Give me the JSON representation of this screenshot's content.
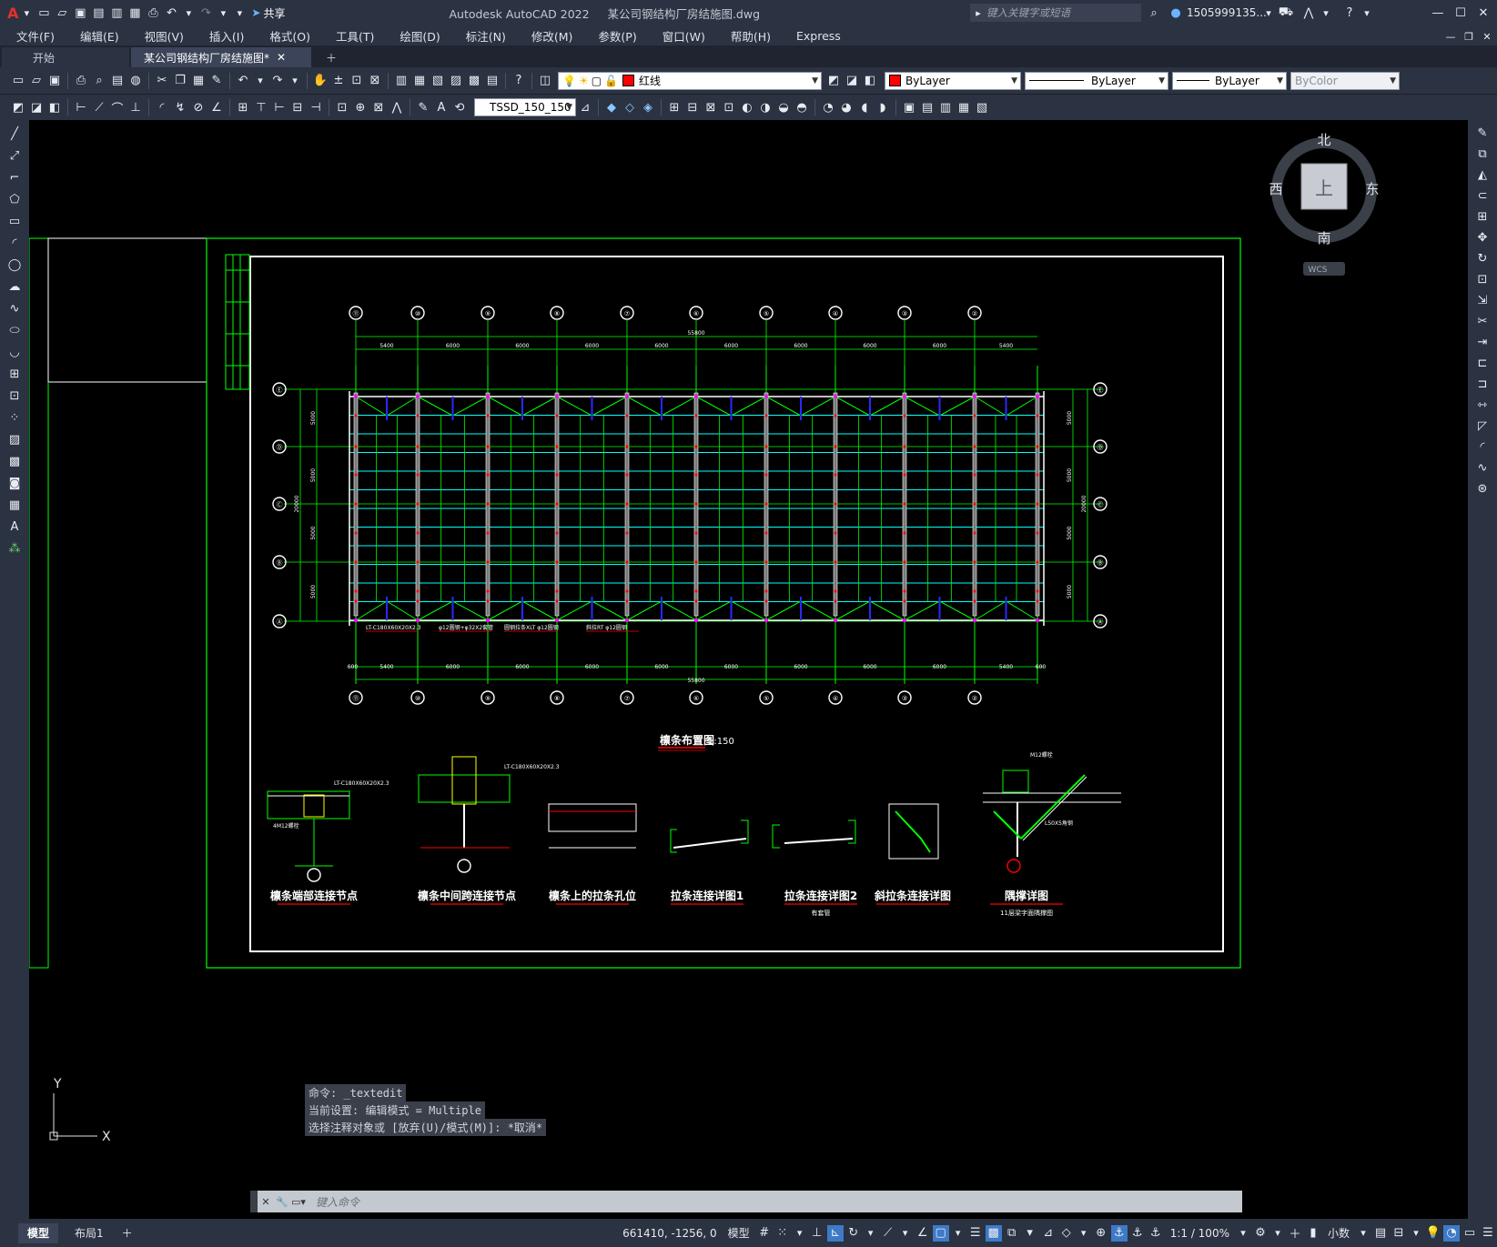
{
  "window": {
    "app_title": "Autodesk AutoCAD 2022",
    "file_title": "某公司钢结构厂房结施图.dwg",
    "search_placeholder": "键入关键字或短语",
    "user": "1505999135...",
    "share_label": "共享"
  },
  "menu": [
    "文件(F)",
    "编辑(E)",
    "视图(V)",
    "插入(I)",
    "格式(O)",
    "工具(T)",
    "绘图(D)",
    "标注(N)",
    "修改(M)",
    "参数(P)",
    "窗口(W)",
    "帮助(H)",
    "Express"
  ],
  "tabs": [
    {
      "label": "开始",
      "active": false
    },
    {
      "label": "某公司钢结构厂房结施图*",
      "active": true
    }
  ],
  "toolbar": {
    "layer_name": "红线",
    "color": "ByLayer",
    "linetype": "ByLayer",
    "lineweight": "ByLayer",
    "plotstyle": "ByColor",
    "dimstyle": "TSSD_150_150"
  },
  "viewcube": {
    "north": "北",
    "south": "南",
    "east": "东",
    "west": "西",
    "face": "上",
    "wcs": "WCS"
  },
  "drawing": {
    "plan_title": "檩条布置图",
    "plan_scale": "1:150",
    "total_dim": "55800",
    "top_dims": [
      "5400",
      "6000",
      "6000",
      "6000",
      "6000",
      "6000",
      "6000",
      "6000",
      "6000",
      "5400"
    ],
    "bottom_dims": [
      "600",
      "5400",
      "6000",
      "6000",
      "6000",
      "6000",
      "6000",
      "6000",
      "6000",
      "6000",
      "5400",
      "600"
    ],
    "side_dims": [
      "5000",
      "5000",
      "5000",
      "5000"
    ],
    "side_total": "20000",
    "grid_top": [
      "⑪",
      "⑩",
      "⑨",
      "⑧",
      "⑦",
      "⑥",
      "⑤",
      "④",
      "③",
      "②"
    ],
    "grid_side": [
      "Ⓔ",
      "Ⓓ",
      "Ⓒ",
      "Ⓑ",
      "Ⓐ"
    ],
    "callouts": [
      "LT-C180X60X20X2.3",
      "φ12圆钢+φ32X2套管",
      "圆钢拉条XLT φ12圆钢",
      "斜拉RT φ12圆钢"
    ],
    "detail_titles": [
      "檩条端部连接节点",
      "檩条中间跨连接节点",
      "檩条上的拉条孔位",
      "拉条连接详图1",
      "拉条连接详图2",
      "斜拉条连接详图",
      "隅撑详图"
    ],
    "detail_subs": [
      "",
      "",
      "",
      "",
      "有套管",
      "",
      "11层梁字面隅撑图"
    ],
    "detail_labels": [
      "LT-C180X60X20X2.3",
      "LT-C180X60X20X2.3",
      "LT-C180X60X20X2.3",
      "4M12螺栓",
      "M12螺栓",
      "L50X5角钢"
    ]
  },
  "ucs": {
    "x": "X",
    "y": "Y"
  },
  "command": {
    "history": [
      "命令: _textedit",
      "当前设置: 编辑模式 = Multiple",
      "选择注释对象或 [放弃(U)/模式(M)]: *取消*"
    ],
    "input_placeholder": "键入命令"
  },
  "status": {
    "coords": "661410, -1256, 0",
    "space": "模型",
    "layout_tabs": [
      "模型",
      "布局1"
    ],
    "annoscale": "1:1 / 100%",
    "units": "小数"
  },
  "colors": {
    "chrome": "#2b3241",
    "green": "#00ff00",
    "cyan": "#00ffff",
    "red": "#ff0000",
    "magenta": "#ff00ff",
    "blue": "#0000ff"
  }
}
